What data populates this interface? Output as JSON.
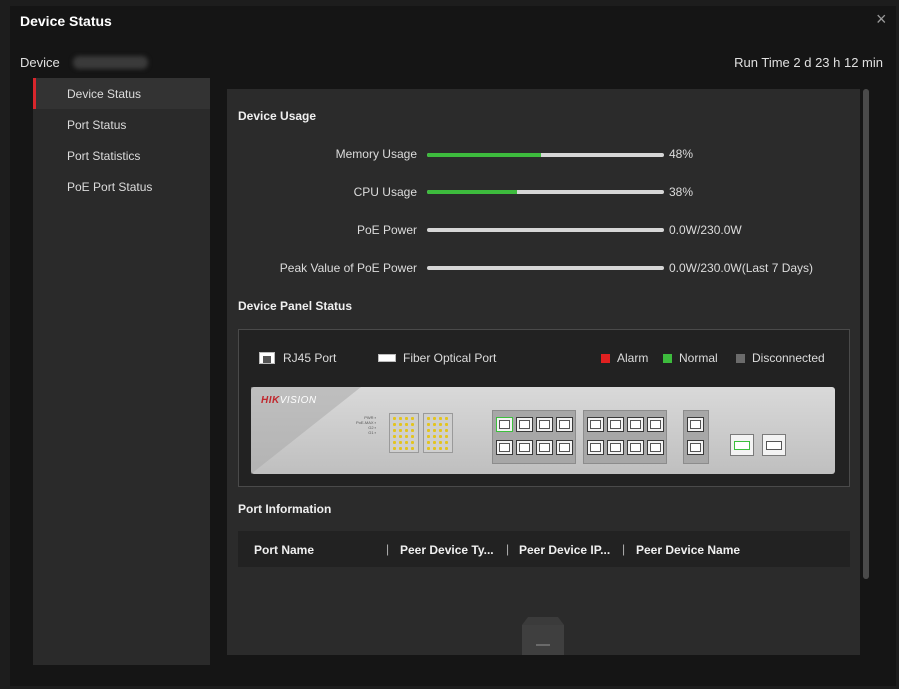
{
  "dialog": {
    "title": "Device Status",
    "close_glyph": "×"
  },
  "device": {
    "label": "Device",
    "run_time": "Run Time 2 d 23 h 12 min"
  },
  "sidebar": {
    "items": [
      {
        "label": "Device Status",
        "active": true
      },
      {
        "label": "Port Status",
        "active": false
      },
      {
        "label": "Port Statistics",
        "active": false
      },
      {
        "label": "PoE Port Status",
        "active": false
      }
    ]
  },
  "usage": {
    "title": "Device Usage",
    "rows": [
      {
        "label": "Memory Usage",
        "value": "48%",
        "fill": 0.48
      },
      {
        "label": "CPU Usage",
        "value": "38%",
        "fill": 0.38
      },
      {
        "label": "PoE Power",
        "value": "0.0W/230.0W",
        "fill": 0
      },
      {
        "label": "Peak Value of PoE Power",
        "value": "0.0W/230.0W(Last 7 Days)",
        "fill": 0
      }
    ]
  },
  "panel": {
    "title": "Device Panel Status",
    "legend": {
      "rj45": "RJ45 Port",
      "fiber": "Fiber Optical Port",
      "alarm": "Alarm",
      "normal": "Normal",
      "disconnected": "Disconnected"
    },
    "brand": {
      "red": "HIK",
      "white": "VISION"
    },
    "status_colors": {
      "alarm": "#e02020",
      "normal": "#3dbb3d",
      "disconnected": "#6b6b6b"
    }
  },
  "port_info": {
    "title": "Port Information",
    "columns": [
      "Port Name",
      "Peer Device Ty...",
      "Peer Device IP...",
      "Peer Device Name"
    ]
  }
}
